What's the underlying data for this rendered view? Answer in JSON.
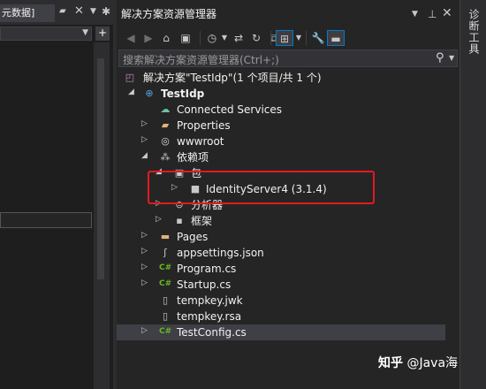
{
  "left_panel": {
    "tab_label": "元数据]",
    "pin_icon": "pin-icon",
    "close_icon": "close-icon",
    "gear_icon": "gear-icon"
  },
  "solution_explorer": {
    "title": "解决方案资源管理器",
    "search": {
      "placeholder": "搜索解决方案资源管理器(Ctrl+;)"
    },
    "tree": [
      {
        "label": "解决方案\"TestIdp\"(1 个项目/共 1 个)",
        "icon": "solution-icon",
        "expander": "",
        "bold": false
      },
      {
        "label": "TestIdp",
        "icon": "web-project-icon",
        "expander": "◢",
        "bold": true
      },
      {
        "label": "Connected Services",
        "icon": "cloud-icon",
        "expander": "",
        "bold": false
      },
      {
        "label": "Properties",
        "icon": "wrench-folder-icon",
        "expander": "▷",
        "bold": false
      },
      {
        "label": "wwwroot",
        "icon": "globe-icon",
        "expander": "▷",
        "bold": false
      },
      {
        "label": "依赖项",
        "icon": "dependencies-icon",
        "expander": "◢",
        "bold": false
      },
      {
        "label": "包",
        "icon": "package-icon",
        "expander": "◢",
        "bold": false
      },
      {
        "label": "IdentityServer4 (3.1.4)",
        "icon": "nuget-package-icon",
        "expander": "▷",
        "bold": false
      },
      {
        "label": "分析器",
        "icon": "analyzer-icon",
        "expander": "▷",
        "bold": false
      },
      {
        "label": "框架",
        "icon": "framework-icon",
        "expander": "▷",
        "bold": false
      },
      {
        "label": "Pages",
        "icon": "folder-icon",
        "expander": "▷",
        "bold": false
      },
      {
        "label": "appsettings.json",
        "icon": "json-file-icon",
        "expander": "▷",
        "bold": false
      },
      {
        "label": "Program.cs",
        "icon": "csharp-file-icon",
        "expander": "▷",
        "bold": false
      },
      {
        "label": "Startup.cs",
        "icon": "csharp-file-icon",
        "expander": "▷",
        "bold": false
      },
      {
        "label": "tempkey.jwk",
        "icon": "file-icon",
        "expander": "",
        "bold": false
      },
      {
        "label": "tempkey.rsa",
        "icon": "file-icon",
        "expander": "",
        "bold": false
      },
      {
        "label": "TestConfig.cs",
        "icon": "csharp-file-icon",
        "expander": "▷",
        "bold": false
      }
    ],
    "selected_item": "TestConfig.cs"
  },
  "right_strip": {
    "label": "诊断工具"
  },
  "watermark": {
    "logo": "知乎",
    "handle": "@Java海"
  },
  "colors": {
    "accent": "#007acc",
    "highlight_box": "#e5191d",
    "csharp": "#68b723",
    "folder": "#dcb67a"
  }
}
